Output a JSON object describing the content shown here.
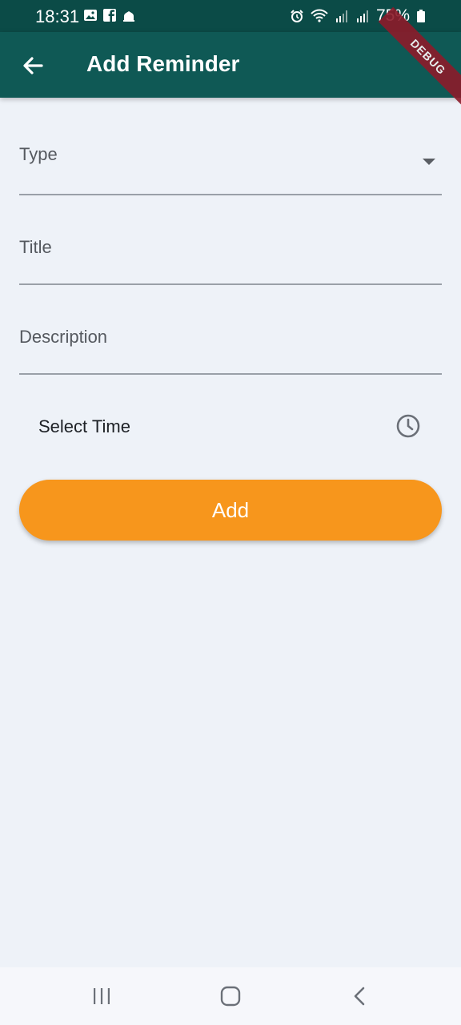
{
  "status_bar": {
    "time": "18:31",
    "battery": "75%",
    "icons_left": [
      "image-icon",
      "facebook-icon",
      "mosque-icon"
    ],
    "icons_right": [
      "alarm-icon",
      "wifi-icon",
      "signal-icon",
      "signal-icon",
      "battery-icon"
    ]
  },
  "app_bar": {
    "title": "Add Reminder",
    "background": "#0f5955"
  },
  "debug_banner": "DEBUG",
  "form": {
    "type_label": "Type",
    "title_label": "Title",
    "description_label": "Description",
    "select_time_label": "Select Time"
  },
  "add_button": {
    "label": "Add",
    "color": "#f7961c"
  },
  "nav_bar": {
    "icons": [
      "recent-apps-icon",
      "home-icon",
      "back-icon"
    ]
  }
}
